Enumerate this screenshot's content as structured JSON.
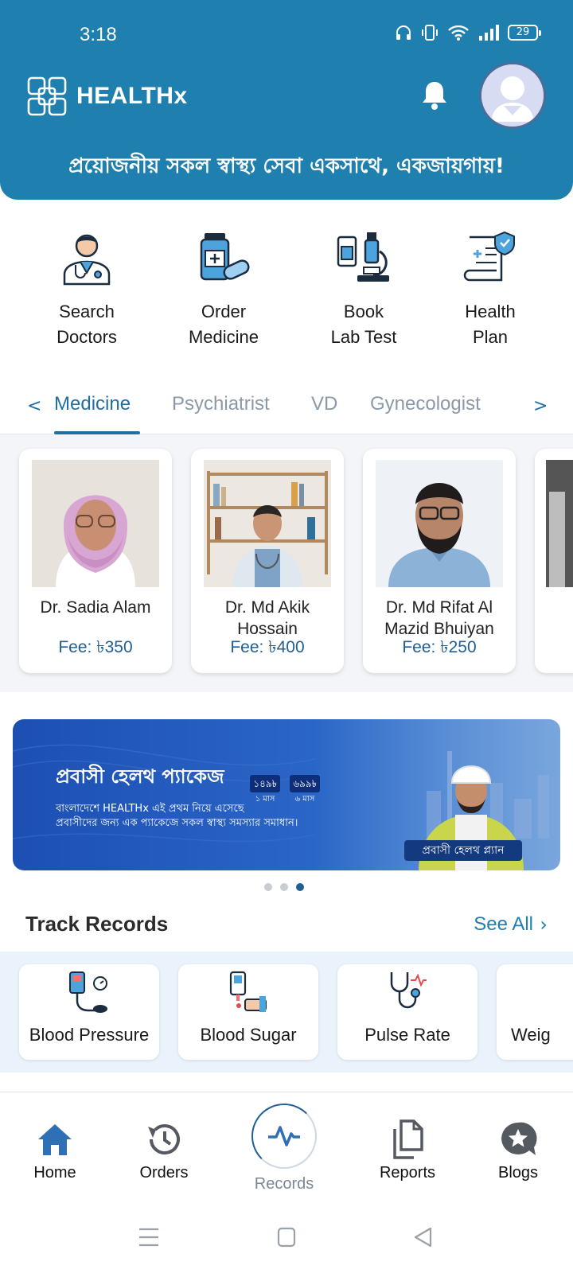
{
  "status_bar": {
    "time": "3:18",
    "battery": "29"
  },
  "header": {
    "brand": "HEALTHx",
    "tagline": "প্রয়োজনীয় সকল স্বাস্থ্য সেবা একসাথে, একজায়গায়!",
    "icons": {
      "bell": "bell-icon",
      "avatar": "profile-avatar"
    },
    "colors": {
      "primary": "#1f7fae"
    }
  },
  "services": [
    {
      "line1": "Search",
      "line2": "Doctors",
      "icon": "doctor-icon"
    },
    {
      "line1": "Order",
      "line2": "Medicine",
      "icon": "medicine-bottle-icon"
    },
    {
      "line1": "Book",
      "line2": "Lab Test",
      "icon": "microscope-icon"
    },
    {
      "line1": "Health",
      "line2": "Plan",
      "icon": "health-plan-icon"
    }
  ],
  "specialty_tabs": {
    "prev": "<",
    "next": ">",
    "items": [
      "Medicine",
      "Psychiatrist",
      "VD",
      "Gynecologist"
    ],
    "active": "Medicine"
  },
  "doctors": [
    {
      "name": "Dr. Sadia Alam",
      "fee": "Fee: ৳350"
    },
    {
      "name": "Dr. Md Akik Hossain",
      "fee": "Fee: ৳400"
    },
    {
      "name": "Dr. Md Rifat Al Mazid Bhuiyan",
      "fee": "Fee: ৳250"
    }
  ],
  "banner": {
    "title": "প্রবাসী হেলথ প্যাকেজ",
    "line1": "বাংলাদেশে HEALTHx এই প্রথম নিয়ে এসেছে",
    "line2": "প্রবাসীদের জন্য এক প্যাকেজে সকল স্বাস্থ্য সমস্যার সমাধান।",
    "price1": "১৪৯৳",
    "price1_period": "১ মাস",
    "price2": "৬৯৯৳",
    "price2_period": "৬ মাস",
    "plan_label": "প্রবাসী হেলথ প্ল্যান",
    "carousel_active_index": 3,
    "carousel_count": 3
  },
  "track_records": {
    "title": "Track Records",
    "see_all": "See All",
    "items": [
      {
        "label": "Blood Pressure",
        "icon": "blood-pressure-icon"
      },
      {
        "label": "Blood Sugar",
        "icon": "glucometer-icon"
      },
      {
        "label": "Pulse Rate",
        "icon": "stethoscope-icon"
      },
      {
        "label": "Weig",
        "icon": "weight-icon"
      }
    ]
  },
  "bottom_nav": {
    "items": [
      {
        "label": "Home",
        "icon": "home-icon"
      },
      {
        "label": "Orders",
        "icon": "history-icon"
      },
      {
        "label": "Records",
        "icon": "pulse-icon"
      },
      {
        "label": "Reports",
        "icon": "documents-icon"
      },
      {
        "label": "Blogs",
        "icon": "star-chat-icon"
      }
    ],
    "active": "Records"
  }
}
